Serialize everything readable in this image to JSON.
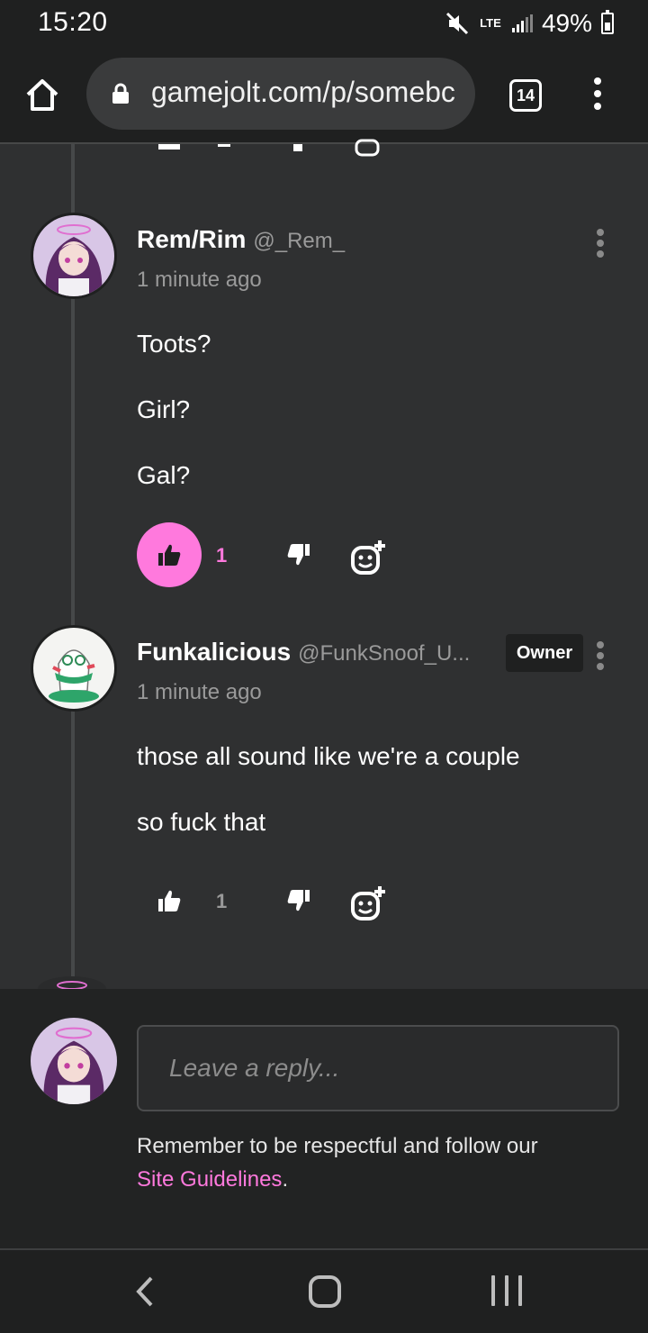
{
  "status_bar": {
    "time": "15:20",
    "network": "LTE",
    "battery": "49%",
    "icons": [
      "mute-icon",
      "lte-icon",
      "signal-icon",
      "battery-icon"
    ]
  },
  "browser": {
    "url": "gamejolt.com/p/somebc",
    "tab_count": "14",
    "icons": [
      "home-icon",
      "lock-icon",
      "tabs-icon",
      "more-vert-icon"
    ]
  },
  "comments": [
    {
      "author": "Rem/Rim",
      "handle": "@_Rem_",
      "time": "1 minute ago",
      "lines": [
        "Toots?",
        "Girl?",
        "Gal?"
      ],
      "likes": "1",
      "liked": true
    },
    {
      "author": "Funkalicious",
      "handle": "@FunkSnoof_U...",
      "badge": "Owner",
      "time": "1 minute ago",
      "lines": [
        "those all sound like we're a couple",
        "so fuck that"
      ],
      "likes": "1",
      "liked": false
    }
  ],
  "reply": {
    "placeholder": "Leave a reply...",
    "note": "Remember to be respectful and follow our",
    "link": "Site Guidelines",
    "note_end": "."
  },
  "colors": {
    "accent": "#ff79dd",
    "background": "#2f3031",
    "bar": "#1f2020",
    "muted_text": "#9a9a9a"
  }
}
